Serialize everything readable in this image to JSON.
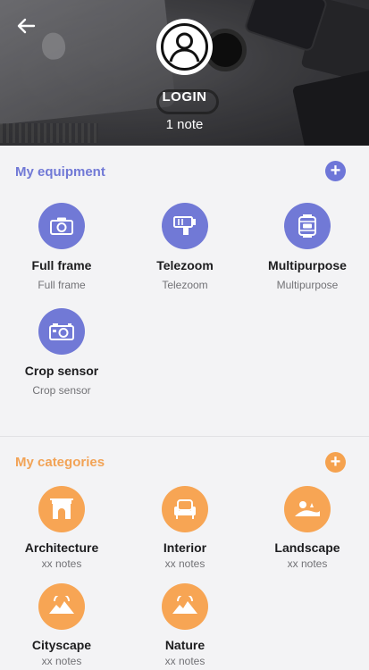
{
  "header": {
    "title": "LOGIN",
    "subtitle": "1 note"
  },
  "equipment": {
    "title": "My equipment",
    "add_label": "+",
    "items": [
      {
        "name": "Full frame",
        "sub": "Full frame",
        "icon": "camera-icon"
      },
      {
        "name": "Telezoom",
        "sub": "Telezoom",
        "icon": "telezoom-lens-icon"
      },
      {
        "name": "Multipurpose",
        "sub": "Multipurpose",
        "icon": "multipurpose-lens-icon"
      },
      {
        "name": "Crop sensor",
        "sub": "Crop sensor",
        "icon": "crop-camera-icon"
      }
    ]
  },
  "categories": {
    "title": "My categories",
    "add_label": "+",
    "items": [
      {
        "name": "Architecture",
        "sub": "xx notes",
        "icon": "arch-icon"
      },
      {
        "name": "Interior",
        "sub": "xx notes",
        "icon": "armchair-icon"
      },
      {
        "name": "Landscape",
        "sub": "xx notes",
        "icon": "landscape-icon"
      },
      {
        "name": "Cityscape",
        "sub": "xx notes",
        "icon": "mountain-icon"
      },
      {
        "name": "Nature",
        "sub": "xx notes",
        "icon": "mountain-icon"
      }
    ]
  },
  "colors": {
    "equipment_accent": "#7179d6",
    "category_accent": "#f7a554"
  }
}
